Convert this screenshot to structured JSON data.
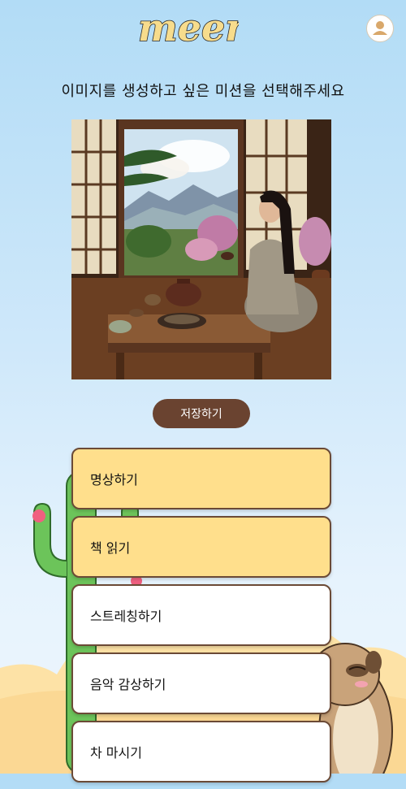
{
  "app": {
    "logo_text": "meer"
  },
  "header": {
    "profile_icon": "user-avatar-icon"
  },
  "main": {
    "title": "이미지를 생성하고 싶은 미션을 선택해주세요",
    "save_label": "저장하기"
  },
  "missions": [
    {
      "label": "명상하기",
      "selected": true
    },
    {
      "label": "책 읽기",
      "selected": true
    },
    {
      "label": "스트레칭하기",
      "selected": false
    },
    {
      "label": "음악 감상하기",
      "selected": false
    },
    {
      "label": "차 마시기",
      "selected": false
    }
  ],
  "colors": {
    "selected_bg": "#ffdf8c",
    "border": "#6b4a36",
    "save_button": "#6a4330"
  }
}
